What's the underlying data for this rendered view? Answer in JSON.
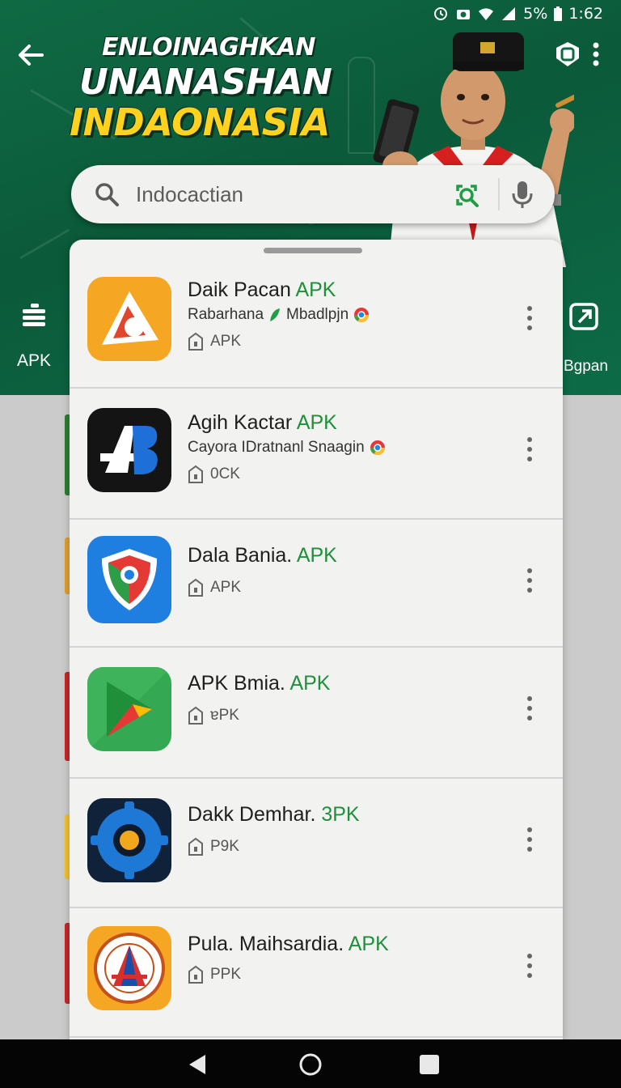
{
  "status_bar": {
    "battery": "5%",
    "time": "1:62"
  },
  "header": {
    "title_lines": [
      "ENLOINAGHKAN",
      "UNANASHAN",
      "INDAONASIA"
    ],
    "colors": {
      "banner": "#0b5a3a",
      "title_accent": "#ffd21f"
    }
  },
  "search": {
    "placeholder": "Indocactian",
    "value": ""
  },
  "categories": {
    "left_label": "APK",
    "right_label": "Bgpan"
  },
  "apps": [
    {
      "name": "Daik Pacan",
      "tag": "APK",
      "developer": "Rabarhana",
      "developer_extra": "Mbadlpjn",
      "type": "APK"
    },
    {
      "name": "Agih Kactar",
      "tag": "APK",
      "developer": "Cayora IDratnanl Snaagin",
      "type": "0CK"
    },
    {
      "name": "Dala Bania.",
      "tag": "APK",
      "type": "APK"
    },
    {
      "name": "APK Bmia.",
      "tag": "APK",
      "type": "ɐPK"
    },
    {
      "name": "Dakk Demhar.",
      "tag": "3PK",
      "type": "P9K"
    },
    {
      "name": "Pula. Maihsardia.",
      "tag": "APK",
      "type": "PPK"
    }
  ],
  "accent_color": "#1f8f3a"
}
